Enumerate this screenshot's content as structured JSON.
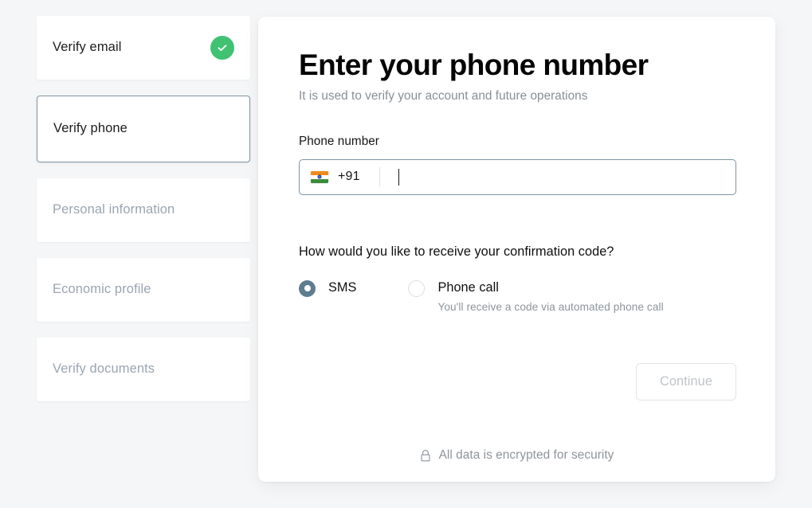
{
  "sidebar": {
    "steps": [
      {
        "label": "Verify email",
        "state": "done",
        "icon": "check-circle-icon"
      },
      {
        "label": "Verify phone",
        "state": "active"
      },
      {
        "label": "Personal information",
        "state": "upcoming"
      },
      {
        "label": "Economic profile",
        "state": "upcoming"
      },
      {
        "label": "Verify documents",
        "state": "upcoming"
      }
    ]
  },
  "main": {
    "title": "Enter your phone number",
    "subtitle": "It is used to verify your account and future operations",
    "phone_field": {
      "label": "Phone number",
      "flag_icon": "india-flag-icon",
      "dial_code": "+91",
      "value": "",
      "placeholder": ""
    },
    "question": "How would you like to receive your confirmation code?",
    "options": [
      {
        "label": "SMS",
        "selected": true,
        "hint": ""
      },
      {
        "label": "Phone call",
        "selected": false,
        "hint": "You'll receive a code via automated phone call"
      }
    ],
    "continue_label": "Continue",
    "footer": {
      "icon": "lock-icon",
      "text": "All data is encrypted for security"
    }
  },
  "colors": {
    "page_background": "#f5f6f7",
    "accent_slate": "#5f7d91",
    "success_green": "#41c273",
    "muted_text": "#8d949b",
    "disabled_text": "#bfc4c9"
  }
}
